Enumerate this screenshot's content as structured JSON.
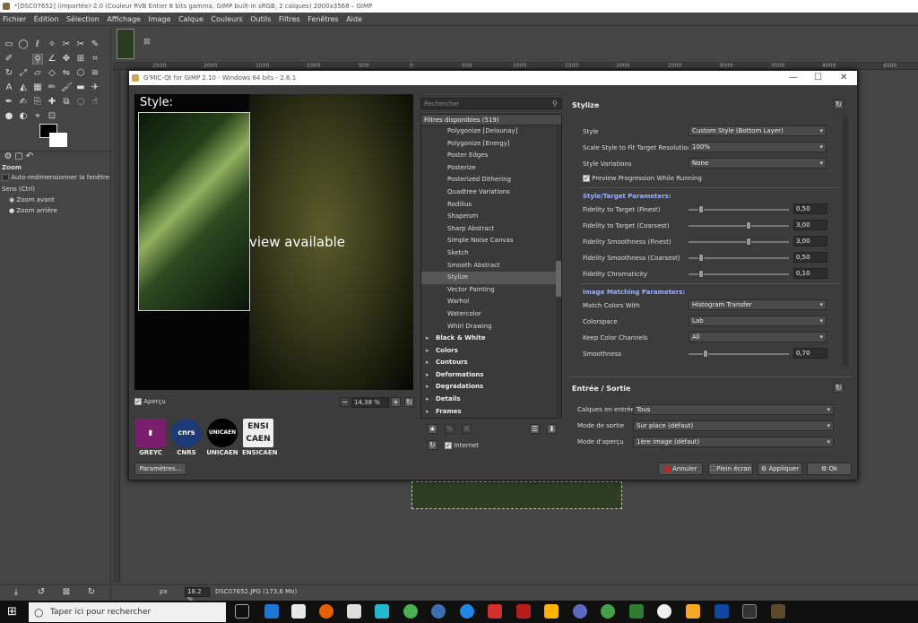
{
  "gimp": {
    "title": "*[DSC07652] (importée)-2.0 (Couleur RVB Entier 8 bits gamma, GIMP built-in sRGB, 2 calques) 2000x3568 – GIMP",
    "menu": [
      "Fichier",
      "Édition",
      "Sélection",
      "Affichage",
      "Image",
      "Calque",
      "Couleurs",
      "Outils",
      "Filtres",
      "Fenêtres",
      "Aide"
    ],
    "tool_options_title": "Zoom",
    "opt_auto_resize": "Auto-redimensionner la fenêtre",
    "opt_direction": "Sens  (Ctrl)",
    "opt_zoom_in": "Zoom avant",
    "opt_zoom_out": "Zoom arrière",
    "ruler_marks": [
      "2500",
      "2000",
      "1500",
      "1000",
      "500",
      "0",
      "500",
      "1000",
      "1500",
      "2000",
      "2500",
      "3000",
      "3500",
      "4000",
      "4500"
    ],
    "status_unit": "px",
    "status_zoom": "18.2 %",
    "status_file": "DSC07652.JPG (173,6 Mo)"
  },
  "gmic": {
    "title": "G'MIC-Qt for GIMP 2.10 - Windows 64 bits - 2.6.1",
    "preview_style_label": "Style:",
    "preview_text": "view available",
    "apercu_label": "Aperçu",
    "zoom_value": "14,38 %",
    "logos": [
      "GREYC",
      "CNRS",
      "UNICAEN",
      "ENSICAEN"
    ],
    "logo_marks": [
      "▮",
      "cnrs",
      "UNICAEN",
      "ENSI CAEN"
    ],
    "params_button": "Paramètres...",
    "search_placeholder": "Rechercher",
    "filters_header": "Filtres disponibles (519)",
    "filters": [
      "Polygonize [Delaunay]",
      "Polygonize [Energy]",
      "Poster Edges",
      "Posterize",
      "Posterized Dithering",
      "Quadtree Variations",
      "Rodilius",
      "Shapeism",
      "Sharp Abstract",
      "Simple Noise Canvas",
      "Sketch",
      "Smooth Abstract",
      "Stylize",
      "Vector Painting",
      "Warhol",
      "Watercolor",
      "Whirl Drawing"
    ],
    "selected_filter": "Stylize",
    "categories": [
      "Black & White",
      "Colors",
      "Contours",
      "Deformations",
      "Degradations",
      "Details",
      "Frames"
    ],
    "internet_label": "Internet",
    "filter_title": "Stylize",
    "style_label": "Style",
    "style_value": "Custom Style (Bottom Layer)",
    "scale_label": "Scale Style to Fit Target Resolution",
    "scale_value": "100%",
    "variations_label": "Style Variations",
    "variations_value": "None",
    "preview_progress_label": "Preview Progression While Running",
    "section_target": "Style/Target Parameters:",
    "sliders": [
      {
        "label": "Fidelity to Target (Finest)",
        "value": "0,50",
        "level": 0.1
      },
      {
        "label": "Fidelity to Target (Coarsest)",
        "value": "3,00",
        "level": 0.6
      },
      {
        "label": "Fidelity Smoothness (Finest)",
        "value": "3,00",
        "level": 0.6
      },
      {
        "label": "Fidelity Smoothness (Coarsest)",
        "value": "0,50",
        "level": 0.1
      },
      {
        "label": "Fidelity Chromaticity",
        "value": "0,10",
        "level": 0.1
      }
    ],
    "section_matching": "Image Matching Parameters:",
    "match_label": "Match Colors With",
    "match_value": "Histogram Transfer",
    "colorspace_label": "Colorspace",
    "colorspace_value": "Lab",
    "keep_label": "Keep Color Channels",
    "keep_value": "All",
    "smoothness_label": "Smoothness",
    "smoothness_value": "0,70",
    "smoothness_level": 0.15,
    "io_title": "Entrée / Sortie",
    "io_input_label": "Calques en entrée",
    "io_input_value": "Tous",
    "io_output_label": "Mode de sortie",
    "io_output_value": "Sur place (défaut)",
    "io_preview_label": "Mode d'aperçu",
    "io_preview_value": "1ère image (défaut)",
    "btn_cancel": "Annuler",
    "btn_fullscreen": "Plein écran",
    "btn_apply": "Appliquer",
    "btn_ok": "Ok"
  },
  "taskbar": {
    "search_placeholder": "Taper ici pour rechercher"
  },
  "colors": {
    "accent_link": "#9ab0ff",
    "cancel_red": "#d62020"
  }
}
